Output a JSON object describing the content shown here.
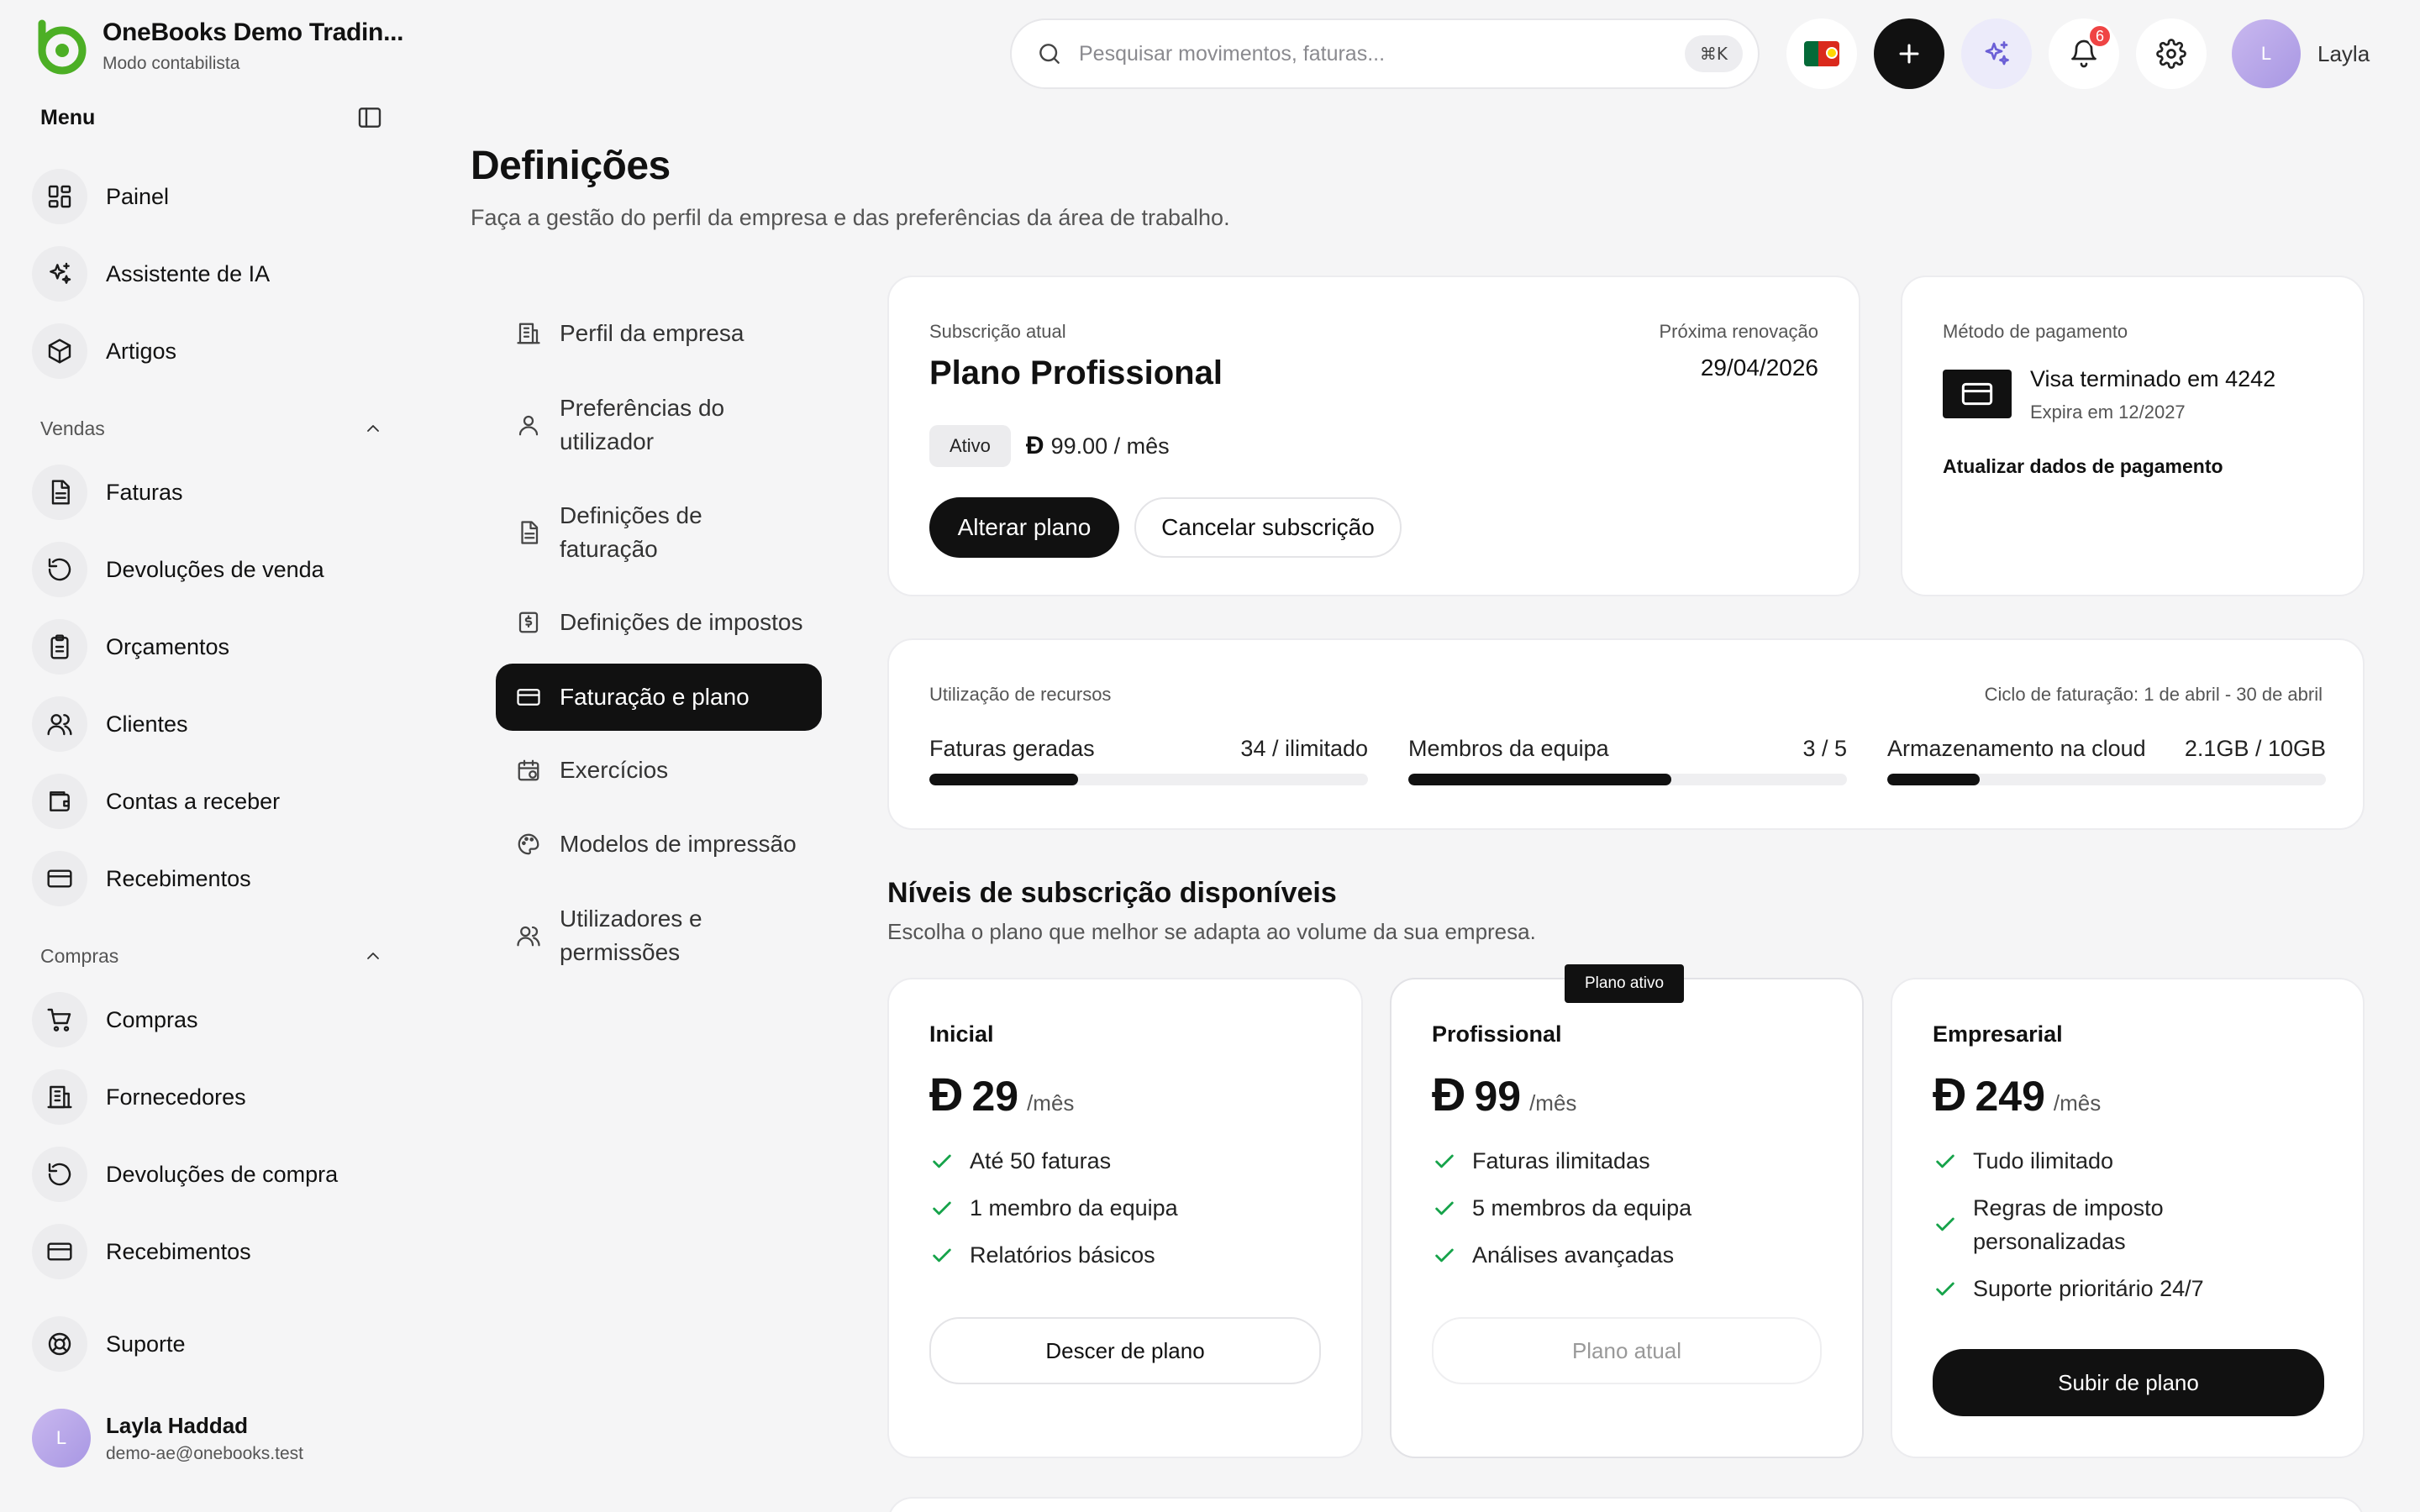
{
  "brand": {
    "name": "OneBooks Demo Tradin...",
    "mode": "Modo contabilista",
    "logo_color": "#4caf25"
  },
  "sidebar": {
    "menu_title": "Menu",
    "top_items": [
      {
        "label": "Painel",
        "icon": "dashboard-icon"
      },
      {
        "label": "Assistente de IA",
        "icon": "sparkles-icon"
      },
      {
        "label": "Artigos",
        "icon": "box-icon"
      }
    ],
    "sales": {
      "label": "Vendas",
      "items": [
        {
          "label": "Faturas",
          "icon": "invoice-icon"
        },
        {
          "label": "Devoluções de venda",
          "icon": "return-icon"
        },
        {
          "label": "Orçamentos",
          "icon": "clipboard-icon"
        },
        {
          "label": "Clientes",
          "icon": "users-icon"
        },
        {
          "label": "Contas a receber",
          "icon": "wallet-icon"
        },
        {
          "label": "Recebimentos",
          "icon": "card-icon"
        }
      ]
    },
    "purchases": {
      "label": "Compras",
      "items": [
        {
          "label": "Compras",
          "icon": "cart-icon"
        },
        {
          "label": "Fornecedores",
          "icon": "building-icon"
        },
        {
          "label": "Devoluções de compra",
          "icon": "return-icon"
        },
        {
          "label": "Recebimentos",
          "icon": "card-icon"
        }
      ]
    },
    "support_label": "Suporte",
    "user": {
      "initial": "L",
      "name": "Layla Haddad",
      "email": "demo-ae@onebooks.test"
    }
  },
  "topbar": {
    "search_placeholder": "Pesquisar movimentos, faturas...",
    "search_shortcut": "⌘K",
    "notifications_count": "6",
    "user_initial": "L",
    "user_name": "Layla"
  },
  "page": {
    "title": "Definições",
    "subtitle": "Faça a gestão do perfil da empresa e das preferências da área de trabalho."
  },
  "settings_nav": [
    {
      "label": "Perfil da empresa",
      "icon": "building-icon",
      "active": false
    },
    {
      "label": "Preferências do utilizador",
      "icon": "user-icon",
      "active": false
    },
    {
      "label": "Definições de faturação",
      "icon": "document-icon",
      "active": false
    },
    {
      "label": "Definições de impostos",
      "icon": "tax-icon",
      "active": false
    },
    {
      "label": "Faturação e plano",
      "icon": "card-icon",
      "active": true
    },
    {
      "label": "Exercícios",
      "icon": "calendar-icon",
      "active": false
    },
    {
      "label": "Modelos de impressão",
      "icon": "palette-icon",
      "active": false
    },
    {
      "label": "Utilizadores e permissões",
      "icon": "users-icon",
      "active": false
    }
  ],
  "subscription": {
    "label": "Subscrição atual",
    "plan": "Plano Profissional",
    "renewal_label": "Próxima renovação",
    "renewal_date": "29/04/2026",
    "status": "Ativo",
    "currency_symbol": "Đ",
    "price_text": "99.00 / mês",
    "change_plan": "Alterar plano",
    "cancel": "Cancelar subscrição"
  },
  "payment": {
    "label": "Método de pagamento",
    "card": "Visa terminado em 4242",
    "expiry": "Expira em 12/2027",
    "update": "Atualizar dados de pagamento"
  },
  "usage": {
    "label": "Utilização de recursos",
    "cycle": "Ciclo de faturação: 1 de abril - 30 de abril",
    "items": [
      {
        "label": "Faturas geradas",
        "value": "34 / ilimitado",
        "fraction": 0.34
      },
      {
        "label": "Membros da equipa",
        "value": "3 / 5",
        "fraction": 0.6
      },
      {
        "label": "Armazenamento na cloud",
        "value": "2.1GB / 10GB",
        "fraction": 0.21
      }
    ]
  },
  "tiers": {
    "title": "Níveis de subscrição disponíveis",
    "subtitle": "Escolha o plano que melhor se adapta ao volume da sua empresa.",
    "active_tag": "Plano ativo",
    "plans": [
      {
        "name": "Inicial",
        "currency": "Đ",
        "price": "29",
        "period": "/mês",
        "features": [
          "Até 50 faturas",
          "1 membro da equipa",
          "Relatórios básicos"
        ],
        "button": "Descer de plano"
      },
      {
        "name": "Profissional",
        "currency": "Đ",
        "price": "99",
        "period": "/mês",
        "features": [
          "Faturas ilimitadas",
          "5 membros da equipa",
          "Análises avançadas"
        ],
        "button": "Plano atual"
      },
      {
        "name": "Empresarial",
        "currency": "Đ",
        "price": "249",
        "period": "/mês",
        "features": [
          "Tudo ilimitado",
          "Regras de imposto personalizadas",
          "Suporte prioritário 24/7"
        ],
        "button": "Subir de plano"
      }
    ]
  },
  "colors": {
    "accent_dark": "#111111",
    "success_check": "#16a34a",
    "notification_badge": "#ef4444",
    "ai_button_bg": "#ecebfa"
  }
}
